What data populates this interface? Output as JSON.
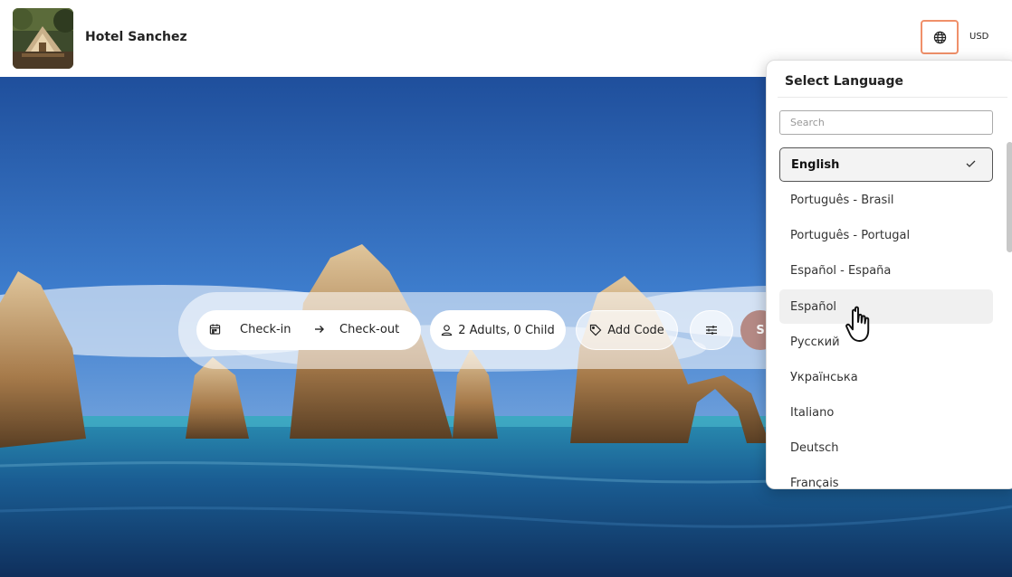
{
  "header": {
    "hotel_name": "Hotel Sanchez",
    "currency": "USD"
  },
  "search": {
    "check_in": "Check-in",
    "check_out": "Check-out",
    "guests": "2 Adults, 0 Child",
    "add_code": "Add Code",
    "search_label": "S"
  },
  "language_menu": {
    "title": "Select Language",
    "search_placeholder": "Search",
    "selected": "English",
    "items": [
      {
        "label": "English"
      },
      {
        "label": "Português - Brasil"
      },
      {
        "label": "Português - Portugal"
      },
      {
        "label": "Español - España"
      },
      {
        "label": "Español"
      },
      {
        "label": "Русский"
      },
      {
        "label": "Українська"
      },
      {
        "label": "Italiano"
      },
      {
        "label": "Deutsch"
      },
      {
        "label": "Français"
      }
    ]
  },
  "colors": {
    "accent_border": "#f0906a",
    "search_button": "#b58a85"
  }
}
